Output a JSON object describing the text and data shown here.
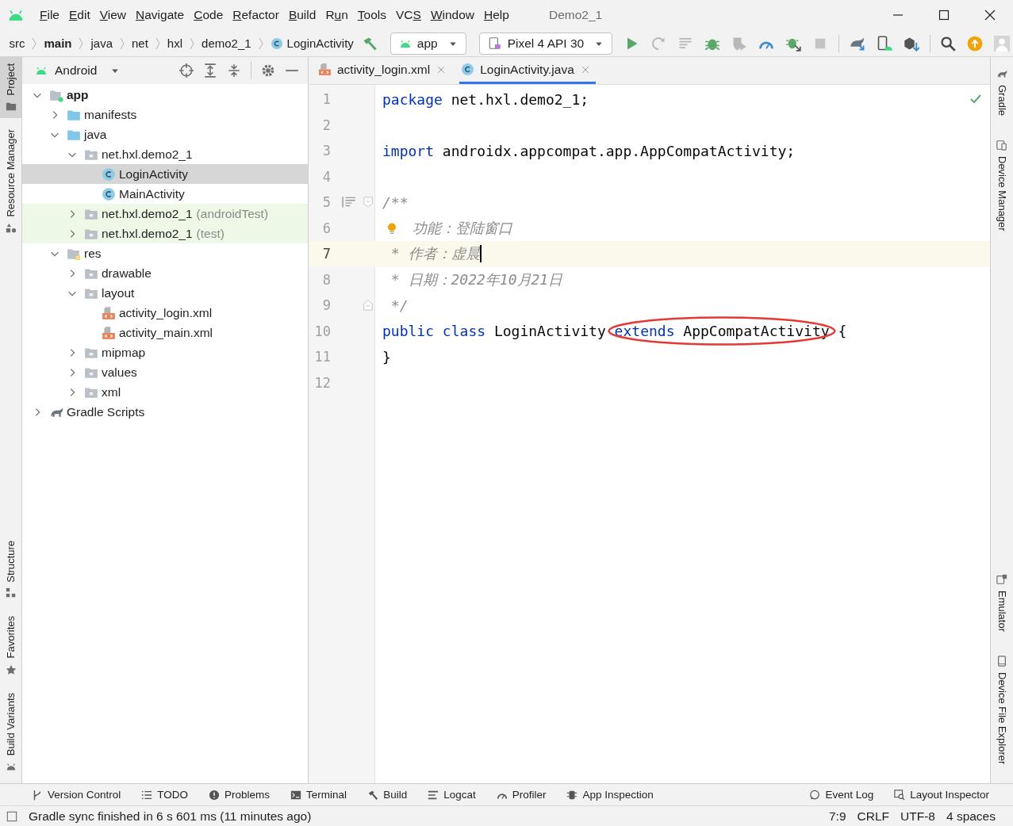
{
  "window": {
    "title": "Demo2_1"
  },
  "menu": [
    {
      "key": "F",
      "post": "ile"
    },
    {
      "key": "E",
      "post": "dit"
    },
    {
      "key": "V",
      "post": "iew"
    },
    {
      "key": "N",
      "post": "avigate"
    },
    {
      "key": "C",
      "post": "ode"
    },
    {
      "key": "R",
      "post": "efactor"
    },
    {
      "key": "B",
      "post": "uild"
    },
    {
      "pre": "R",
      "key": "u",
      "post": "n"
    },
    {
      "key": "T",
      "post": "ools"
    },
    {
      "pre": "VC",
      "key": "S"
    },
    {
      "key": "W",
      "post": "indow"
    },
    {
      "key": "H",
      "post": "elp"
    }
  ],
  "breadcrumbs": [
    {
      "text": "src",
      "bold": false,
      "kind": "folder"
    },
    {
      "text": "main",
      "bold": true,
      "kind": "folder"
    },
    {
      "text": "java",
      "bold": false,
      "kind": "folder"
    },
    {
      "text": "net",
      "bold": false,
      "kind": "folder"
    },
    {
      "text": "hxl",
      "bold": false,
      "kind": "folder"
    },
    {
      "text": "demo2_1",
      "bold": false,
      "kind": "folder"
    },
    {
      "text": "LoginActivity",
      "bold": false,
      "kind": "class"
    }
  ],
  "run_config": {
    "label": "app"
  },
  "device": {
    "label": "Pixel 4 API 30"
  },
  "left_strip": {
    "top": [
      {
        "label": "Project",
        "selected": true
      },
      {
        "label": "Resource Manager",
        "selected": false
      }
    ],
    "bottom": [
      {
        "label": "Structure"
      },
      {
        "label": "Favorites"
      },
      {
        "label": "Build Variants"
      }
    ]
  },
  "project_panel": {
    "view": "Android",
    "tree": [
      {
        "label": "app",
        "kind": "module",
        "expanded": true,
        "selected": false,
        "test": false,
        "children": [
          {
            "label": "manifests",
            "kind": "source-folder",
            "expanded": false,
            "selected": false,
            "test": false
          },
          {
            "label": "java",
            "kind": "source-folder",
            "expanded": true,
            "selected": false,
            "test": false,
            "children": [
              {
                "label": "net.hxl.demo2_1",
                "kind": "package",
                "expanded": true,
                "selected": false,
                "test": false,
                "children": [
                  {
                    "label": "LoginActivity",
                    "kind": "class",
                    "selected": true,
                    "test": false
                  },
                  {
                    "label": "MainActivity",
                    "kind": "class",
                    "selected": false,
                    "test": false
                  }
                ]
              },
              {
                "label": "net.hxl.demo2_1",
                "suffix": "(androidTest)",
                "kind": "package",
                "expanded": false,
                "selected": false,
                "test": true
              },
              {
                "label": "net.hxl.demo2_1",
                "suffix": "(test)",
                "kind": "package",
                "expanded": false,
                "selected": false,
                "test": true
              }
            ]
          },
          {
            "label": "res",
            "kind": "res-folder",
            "expanded": true,
            "selected": false,
            "test": false,
            "children": [
              {
                "label": "drawable",
                "kind": "package",
                "expanded": false,
                "selected": false,
                "test": false
              },
              {
                "label": "layout",
                "kind": "package",
                "expanded": true,
                "selected": false,
                "test": false,
                "children": [
                  {
                    "label": "activity_login.xml",
                    "kind": "xml",
                    "selected": false,
                    "test": false
                  },
                  {
                    "label": "activity_main.xml",
                    "kind": "xml",
                    "selected": false,
                    "test": false
                  }
                ]
              },
              {
                "label": "mipmap",
                "kind": "package",
                "expanded": false,
                "selected": false,
                "test": false
              },
              {
                "label": "values",
                "kind": "package",
                "expanded": false,
                "selected": false,
                "test": false
              },
              {
                "label": "xml",
                "kind": "package",
                "expanded": false,
                "selected": false,
                "test": false
              }
            ]
          }
        ]
      },
      {
        "label": "Gradle Scripts",
        "kind": "gradle",
        "expanded": false,
        "selected": false,
        "test": false
      }
    ]
  },
  "editor": {
    "tabs": [
      {
        "label": "activity_login.xml",
        "kind": "xml",
        "selected": false
      },
      {
        "label": "LoginActivity.java",
        "kind": "class",
        "selected": true
      }
    ],
    "lines": [
      {
        "number": "1",
        "current": false,
        "tokens": [
          {
            "kind": "keyword",
            "text": "package"
          },
          {
            "kind": "plain",
            "text": " net.hxl.demo2_1;"
          }
        ]
      },
      {
        "number": "2",
        "current": false
      },
      {
        "number": "3",
        "current": false,
        "tokens": [
          {
            "kind": "keyword",
            "text": "import"
          },
          {
            "kind": "plain",
            "text": " androidx.appcompat.app.AppCompatActivity;"
          }
        ]
      },
      {
        "number": "4",
        "current": false
      },
      {
        "number": "5",
        "current": false,
        "fold_start": true,
        "doc_toggle": true,
        "tokens": [
          {
            "kind": "comment",
            "text": "/**"
          }
        ]
      },
      {
        "number": "6",
        "current": false,
        "bulb": true,
        "tokens": [
          {
            "kind": "comment",
            "text": "功能：登陆窗口"
          }
        ]
      },
      {
        "number": "7",
        "current": true,
        "caret": true,
        "tokens": [
          {
            "kind": "comment",
            "text": " * 作者：虚晨"
          }
        ]
      },
      {
        "number": "8",
        "current": false,
        "tokens": [
          {
            "kind": "comment",
            "text": " * 日期：2022年10月21日"
          }
        ]
      },
      {
        "number": "9",
        "current": false,
        "fold_end": true,
        "tokens": [
          {
            "kind": "comment",
            "text": " */"
          }
        ]
      },
      {
        "number": "10",
        "current": false,
        "tokens": [
          {
            "kind": "keyword",
            "text": "public"
          },
          {
            "kind": "keyword",
            "text": " class"
          },
          {
            "kind": "plain",
            "text": " LoginActivity"
          },
          {
            "kind": "keyword",
            "text": " extends",
            "circled": true
          },
          {
            "kind": "plain",
            "text": " AppCompatActivity",
            "circled": true
          },
          {
            "kind": "plain",
            "text": " {"
          }
        ]
      },
      {
        "number": "11",
        "current": false,
        "tokens": [
          {
            "kind": "plain",
            "text": "}"
          }
        ]
      },
      {
        "number": "12",
        "current": false
      }
    ]
  },
  "right_strip": [
    {
      "label": "Gradle"
    },
    {
      "label": "Device Manager"
    },
    {
      "label": "Emulator"
    },
    {
      "label": "Device File Explorer"
    }
  ],
  "tool_windows": {
    "left": [
      {
        "label": "Version Control"
      },
      {
        "label": "TODO"
      },
      {
        "label": "Problems"
      },
      {
        "label": "Terminal"
      },
      {
        "label": "Build"
      },
      {
        "label": "Logcat"
      },
      {
        "label": "Profiler"
      },
      {
        "label": "App Inspection"
      }
    ],
    "right": [
      {
        "label": "Event Log"
      },
      {
        "label": "Layout Inspector"
      }
    ]
  },
  "status_bar": {
    "message": "Gradle sync finished in 6 s 601 ms (11 minutes ago)",
    "position": "7:9",
    "line_separator": "CRLF",
    "encoding": "UTF-8",
    "indent": "4 spaces"
  }
}
